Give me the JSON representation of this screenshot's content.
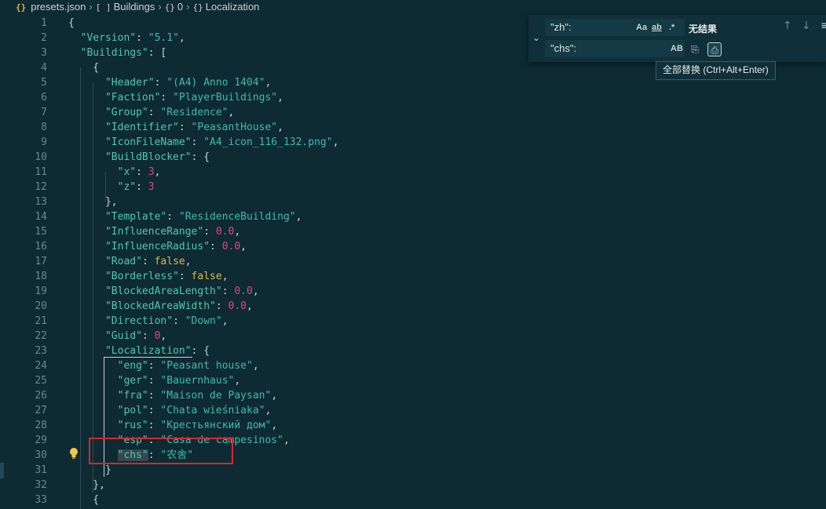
{
  "breadcrumb": {
    "file_icon": "{}",
    "file_name": "presets.json",
    "crumbs": [
      {
        "icon": "[ ]",
        "label": "Buildings"
      },
      {
        "icon": "{}",
        "label": "0"
      },
      {
        "icon": "{}",
        "label": "Localization"
      }
    ]
  },
  "find_widget": {
    "find_value": "\"zh\":",
    "replace_value": "\"chs\":",
    "match_case": "Aa",
    "whole_word": "ab",
    "regex": ".*",
    "preserve_case": "AB",
    "result_text": "无结果",
    "replace_all_tooltip": "全部替换 (Ctrl+Alt+Enter)"
  },
  "code_lines": [
    {
      "n": "1",
      "t": [
        [
          "p",
          "{"
        ]
      ]
    },
    {
      "n": "2",
      "t": [
        [
          "p",
          "  "
        ],
        [
          "k",
          "\"Version\""
        ],
        [
          "p",
          ": "
        ],
        [
          "s",
          "\"5.1\""
        ],
        [
          "p",
          ","
        ]
      ]
    },
    {
      "n": "3",
      "t": [
        [
          "p",
          "  "
        ],
        [
          "k",
          "\"Buildings\""
        ],
        [
          "p",
          ": ["
        ]
      ]
    },
    {
      "n": "4",
      "t": [
        [
          "p",
          "    {"
        ]
      ]
    },
    {
      "n": "5",
      "t": [
        [
          "p",
          "      "
        ],
        [
          "k",
          "\"Header\""
        ],
        [
          "p",
          ": "
        ],
        [
          "s",
          "\"(A4) Anno 1404\""
        ],
        [
          "p",
          ","
        ]
      ]
    },
    {
      "n": "6",
      "t": [
        [
          "p",
          "      "
        ],
        [
          "k",
          "\"Faction\""
        ],
        [
          "p",
          ": "
        ],
        [
          "s",
          "\"PlayerBuildings\""
        ],
        [
          "p",
          ","
        ]
      ]
    },
    {
      "n": "7",
      "t": [
        [
          "p",
          "      "
        ],
        [
          "k",
          "\"Group\""
        ],
        [
          "p",
          ": "
        ],
        [
          "s",
          "\"Residence\""
        ],
        [
          "p",
          ","
        ]
      ]
    },
    {
      "n": "8",
      "t": [
        [
          "p",
          "      "
        ],
        [
          "k",
          "\"Identifier\""
        ],
        [
          "p",
          ": "
        ],
        [
          "s",
          "\"PeasantHouse\""
        ],
        [
          "p",
          ","
        ]
      ]
    },
    {
      "n": "9",
      "t": [
        [
          "p",
          "      "
        ],
        [
          "k",
          "\"IconFileName\""
        ],
        [
          "p",
          ": "
        ],
        [
          "s",
          "\"A4_icon_116_132.png\""
        ],
        [
          "p",
          ","
        ]
      ]
    },
    {
      "n": "10",
      "t": [
        [
          "p",
          "      "
        ],
        [
          "k",
          "\"BuildBlocker\""
        ],
        [
          "p",
          ": {"
        ]
      ]
    },
    {
      "n": "11",
      "t": [
        [
          "p",
          "        "
        ],
        [
          "k",
          "\"x\""
        ],
        [
          "p",
          ": "
        ],
        [
          "n",
          "3"
        ],
        [
          "p",
          ","
        ]
      ]
    },
    {
      "n": "12",
      "t": [
        [
          "p",
          "        "
        ],
        [
          "k",
          "\"z\""
        ],
        [
          "p",
          ": "
        ],
        [
          "n",
          "3"
        ]
      ]
    },
    {
      "n": "13",
      "t": [
        [
          "p",
          "      },"
        ]
      ]
    },
    {
      "n": "14",
      "t": [
        [
          "p",
          "      "
        ],
        [
          "k",
          "\"Template\""
        ],
        [
          "p",
          ": "
        ],
        [
          "s",
          "\"ResidenceBuilding\""
        ],
        [
          "p",
          ","
        ]
      ]
    },
    {
      "n": "15",
      "t": [
        [
          "p",
          "      "
        ],
        [
          "k",
          "\"InfluenceRange\""
        ],
        [
          "p",
          ": "
        ],
        [
          "n",
          "0.0"
        ],
        [
          "p",
          ","
        ]
      ]
    },
    {
      "n": "16",
      "t": [
        [
          "p",
          "      "
        ],
        [
          "k",
          "\"InfluenceRadius\""
        ],
        [
          "p",
          ": "
        ],
        [
          "n",
          "0.0"
        ],
        [
          "p",
          ","
        ]
      ]
    },
    {
      "n": "17",
      "t": [
        [
          "p",
          "      "
        ],
        [
          "k",
          "\"Road\""
        ],
        [
          "p",
          ": "
        ],
        [
          "b",
          "false"
        ],
        [
          "p",
          ","
        ]
      ]
    },
    {
      "n": "18",
      "t": [
        [
          "p",
          "      "
        ],
        [
          "k",
          "\"Borderless\""
        ],
        [
          "p",
          ": "
        ],
        [
          "b",
          "false"
        ],
        [
          "p",
          ","
        ]
      ]
    },
    {
      "n": "19",
      "t": [
        [
          "p",
          "      "
        ],
        [
          "k",
          "\"BlockedAreaLength\""
        ],
        [
          "p",
          ": "
        ],
        [
          "n",
          "0.0"
        ],
        [
          "p",
          ","
        ]
      ]
    },
    {
      "n": "20",
      "t": [
        [
          "p",
          "      "
        ],
        [
          "k",
          "\"BlockedAreaWidth\""
        ],
        [
          "p",
          ": "
        ],
        [
          "n",
          "0.0"
        ],
        [
          "p",
          ","
        ]
      ]
    },
    {
      "n": "21",
      "t": [
        [
          "p",
          "      "
        ],
        [
          "k",
          "\"Direction\""
        ],
        [
          "p",
          ": "
        ],
        [
          "s",
          "\"Down\""
        ],
        [
          "p",
          ","
        ]
      ]
    },
    {
      "n": "22",
      "t": [
        [
          "p",
          "      "
        ],
        [
          "k",
          "\"Guid\""
        ],
        [
          "p",
          ": "
        ],
        [
          "n",
          "0"
        ],
        [
          "p",
          ","
        ]
      ]
    },
    {
      "n": "23",
      "t": [
        [
          "p",
          "      "
        ],
        [
          "k",
          "\"Localization\""
        ],
        [
          "p",
          ": {"
        ]
      ]
    },
    {
      "n": "24",
      "t": [
        [
          "p",
          "        "
        ],
        [
          "k",
          "\"eng\""
        ],
        [
          "p",
          ": "
        ],
        [
          "s",
          "\"Peasant house\""
        ],
        [
          "p",
          ","
        ]
      ]
    },
    {
      "n": "25",
      "t": [
        [
          "p",
          "        "
        ],
        [
          "k",
          "\"ger\""
        ],
        [
          "p",
          ": "
        ],
        [
          "s",
          "\"Bauernhaus\""
        ],
        [
          "p",
          ","
        ]
      ]
    },
    {
      "n": "26",
      "t": [
        [
          "p",
          "        "
        ],
        [
          "k",
          "\"fra\""
        ],
        [
          "p",
          ": "
        ],
        [
          "s",
          "\"Maison de Paysan\""
        ],
        [
          "p",
          ","
        ]
      ]
    },
    {
      "n": "27",
      "t": [
        [
          "p",
          "        "
        ],
        [
          "k",
          "\"pol\""
        ],
        [
          "p",
          ": "
        ],
        [
          "s",
          "\"Chata wieśniaka\""
        ],
        [
          "p",
          ","
        ]
      ]
    },
    {
      "n": "28",
      "t": [
        [
          "p",
          "        "
        ],
        [
          "k",
          "\"rus\""
        ],
        [
          "p",
          ": "
        ],
        [
          "s",
          "\"Крестьянский дом\""
        ],
        [
          "p",
          ","
        ]
      ]
    },
    {
      "n": "29",
      "t": [
        [
          "p",
          "        "
        ],
        [
          "k",
          "\"esp\""
        ],
        [
          "p",
          ": "
        ],
        [
          "s",
          "\"Casa de campesinos\""
        ],
        [
          "p",
          ","
        ]
      ]
    },
    {
      "n": "30",
      "t": [
        [
          "p",
          "        "
        ],
        [
          "k",
          "\"chs\""
        ],
        [
          "p",
          ": "
        ],
        [
          "s",
          "\"农舍\""
        ]
      ]
    },
    {
      "n": "31",
      "t": [
        [
          "p",
          "      }"
        ]
      ]
    },
    {
      "n": "32",
      "t": [
        [
          "p",
          "    },"
        ]
      ]
    },
    {
      "n": "33",
      "t": [
        [
          "p",
          "    {"
        ]
      ]
    }
  ],
  "colors": {
    "background": "#0e2a33",
    "key": "#4ec9b0",
    "string": "#3cbcae",
    "number": "#e3457a",
    "boolean": "#d7ba49",
    "highlight_border": "#d8262c"
  },
  "icons": {
    "lightbulb": "lightbulb-icon",
    "collapse": "chevron-down-icon",
    "prev": "arrow-up-icon",
    "next": "arrow-down-icon",
    "replace": "replace-icon",
    "replace_all": "replace-all-icon"
  }
}
